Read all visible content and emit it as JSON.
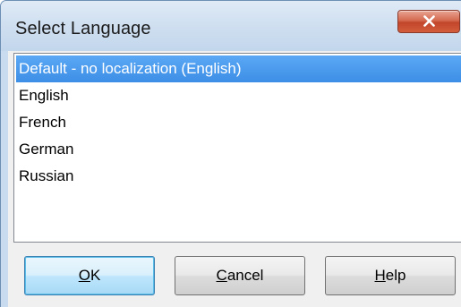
{
  "window": {
    "title": "Select Language",
    "close_icon": "close-x-icon"
  },
  "languages": {
    "items": [
      {
        "label": "Default - no localization (English)",
        "selected": true
      },
      {
        "label": "English",
        "selected": false
      },
      {
        "label": "French",
        "selected": false
      },
      {
        "label": "German",
        "selected": false
      },
      {
        "label": "Russian",
        "selected": false
      }
    ]
  },
  "buttons": {
    "ok": {
      "mnemonic": "O",
      "rest": "K"
    },
    "cancel": {
      "mnemonic": "C",
      "rest": "ancel"
    },
    "help": {
      "mnemonic": "H",
      "rest": "elp"
    }
  },
  "colors": {
    "selection": "#3d8ee6",
    "title_bar": "#c9dcef",
    "close_button": "#c2452a",
    "dialog_background": "#f0f0f0"
  }
}
